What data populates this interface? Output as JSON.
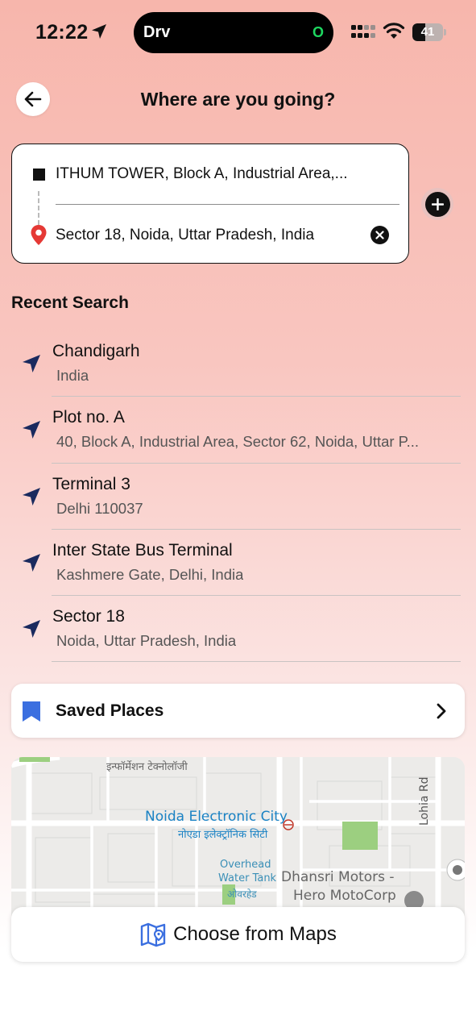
{
  "status_bar": {
    "time": "12:22",
    "island_label": "Drv",
    "island_indicator": "O",
    "battery": "41",
    "battery_level": 0.41
  },
  "header": {
    "title": "Where are you going?"
  },
  "route": {
    "origin": "ITHUM TOWER, Block A, Industrial Area,...",
    "destination": "Sector 18, Noida, Uttar Pradesh, India"
  },
  "recent": {
    "title": "Recent Search",
    "items": [
      {
        "title": "Chandigarh",
        "subtitle": "India"
      },
      {
        "title": "Plot no. A",
        "subtitle": "40, Block A, Industrial Area, Sector 62, Noida, Uttar P..."
      },
      {
        "title": "Terminal 3",
        "subtitle": "Delhi 110037"
      },
      {
        "title": "Inter State Bus Terminal",
        "subtitle": "Kashmere Gate, Delhi, India"
      },
      {
        "title": "Sector 18",
        "subtitle": "Noida, Uttar Pradesh, India"
      }
    ]
  },
  "saved_places": {
    "label": "Saved Places"
  },
  "map": {
    "labels": {
      "it_hindi": "इन्फॉर्मेशन टेक्नोलॉजी",
      "electronic_city": "Noida Electronic City",
      "electronic_city_hindi": "नोएडा इलेक्ट्रॉनिक सिटी",
      "overhead_1": "Overhead",
      "overhead_2": "Water Tank",
      "overhead_hindi": "ओवरहेड",
      "dhansri_1": "Dhansri Motors -",
      "dhansri_2": "Hero MotoCorp",
      "lohia": "Lohia Rd"
    }
  },
  "choose_maps": {
    "label": "Choose from Maps"
  },
  "colors": {
    "accent": "#1a2a5e",
    "marker": "#e53935",
    "bookmark": "#3b6fe0",
    "map_link": "#1a82c4"
  }
}
